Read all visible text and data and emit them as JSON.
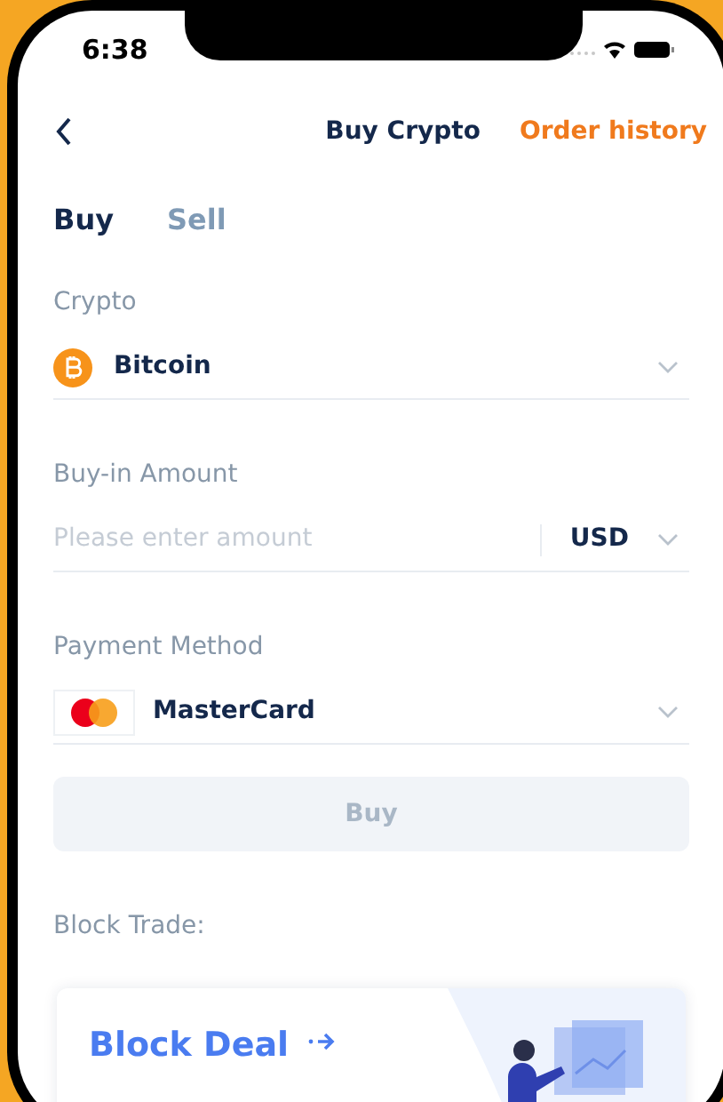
{
  "status_bar": {
    "time": "6:38"
  },
  "header": {
    "title": "Buy Crypto",
    "action": "Order history"
  },
  "tabs": [
    {
      "label": "Buy",
      "selected": true
    },
    {
      "label": "Sell",
      "selected": false
    }
  ],
  "fields": [
    {
      "kind": "crypto",
      "label": "Crypto",
      "value": "Bitcoin"
    },
    {
      "kind": "amount",
      "label": "Buy-in Amount",
      "placeholder": "Please enter amount",
      "currency": "USD"
    },
    {
      "kind": "payment",
      "label": "Payment Method",
      "value": "MasterCard"
    }
  ],
  "buy_button": {
    "label": "Buy",
    "disabled": true
  },
  "block_trade": {
    "heading": "Block Trade:",
    "card_title": "Block Deal"
  }
}
